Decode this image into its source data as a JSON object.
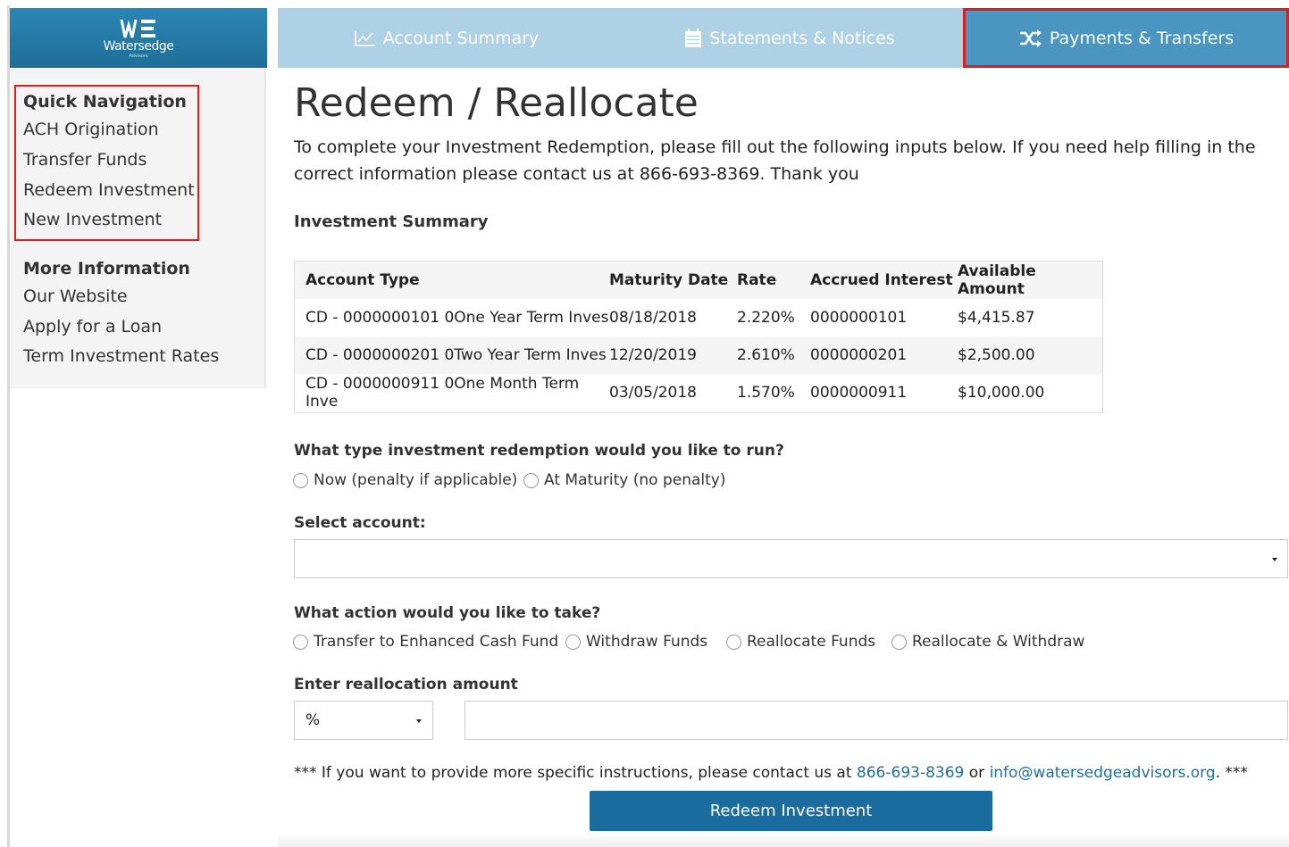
{
  "brand": {
    "name": "Watersedge",
    "sub": "Advisors",
    "color": "#1f6e98"
  },
  "nav": {
    "tabs": [
      {
        "label": "Account Summary",
        "icon": "line-chart-icon"
      },
      {
        "label": "Statements & Notices",
        "icon": "calendar-icon"
      },
      {
        "label": "Payments & Transfers",
        "icon": "shuffle-icon",
        "active": true
      }
    ]
  },
  "sidebar": {
    "quick_heading": "Quick Navigation",
    "quick_links": [
      "ACH Origination",
      "Transfer Funds",
      "Redeem Investment",
      "New Investment"
    ],
    "more_heading": "More Information",
    "more_links": [
      "Our Website",
      "Apply for a Loan",
      "Term Investment Rates"
    ]
  },
  "page": {
    "title": "Redeem / Reallocate",
    "intro": "To complete your Investment Redemption, please fill out the following inputs below. If you need help filling in the correct information please contact us at 866-693-8369. Thank you"
  },
  "summary": {
    "heading": "Investment Summary",
    "columns": [
      "Account Type",
      "Maturity Date",
      "Rate",
      "Accrued Interest",
      "Available Amount"
    ],
    "rows": [
      [
        "CD - 0000000101 0One Year Term Inves",
        "08/18/2018",
        "2.220%",
        "0000000101",
        "$4,415.87"
      ],
      [
        "CD - 0000000201 0Two Year Term Inves",
        "12/20/2019",
        "2.610%",
        "0000000201",
        "$2,500.00"
      ],
      [
        "CD - 0000000911 0One Month Term Inve",
        "03/05/2018",
        "1.570%",
        "0000000911",
        "$10,000.00"
      ]
    ]
  },
  "redemption_type": {
    "question": "What type investment redemption would you like to run?",
    "options": [
      "Now (penalty if applicable)",
      "At Maturity (no penalty)"
    ]
  },
  "account_select": {
    "label": "Select account:",
    "value": ""
  },
  "action": {
    "question": "What action would you like to take?",
    "options": [
      "Transfer to Enhanced Cash Fund",
      "Withdraw Funds",
      "Reallocate Funds",
      "Reallocate & Withdraw"
    ]
  },
  "amount": {
    "label": "Enter reallocation amount",
    "unit": "%",
    "value": ""
  },
  "footer": {
    "prefix": "*** If you want to provide more specific instructions, please contact us at ",
    "phone": "866-693-8369",
    "middle": " or ",
    "email": "info@watersedgeadvisors.org",
    "suffix": ". ***"
  },
  "submit_label": "Redeem Investment",
  "colors": {
    "accent": "#1b6c9e",
    "highlight": "#e01c1c",
    "nav_bg": "#aed1e6",
    "nav_active": "#4a96c0"
  }
}
